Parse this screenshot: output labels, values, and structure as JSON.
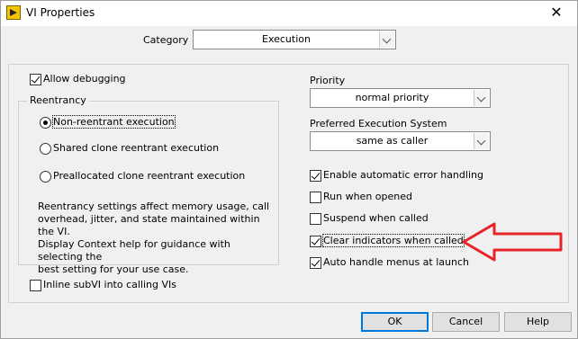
{
  "window": {
    "title": "VI Properties",
    "close_label": "✕"
  },
  "category": {
    "label": "Category",
    "value": "Execution"
  },
  "allow_debugging": {
    "label": "Allow debugging",
    "checked": true
  },
  "reentrancy": {
    "title": "Reentrancy",
    "options": [
      {
        "label": "Non-reentrant execution",
        "selected": true
      },
      {
        "label": "Shared clone reentrant execution",
        "selected": false
      },
      {
        "label": "Preallocated clone reentrant execution",
        "selected": false
      }
    ],
    "description": "Reentrancy settings affect memory usage, call\noverhead, jitter, and state maintained within the VI.\nDisplay Context help for guidance with selecting the\nbest setting for your use case."
  },
  "inline_subvi": {
    "label": "Inline subVI into calling VIs",
    "checked": false
  },
  "priority": {
    "label": "Priority",
    "value": "normal priority"
  },
  "exec_system": {
    "label": "Preferred Execution System",
    "value": "same as caller"
  },
  "options": [
    {
      "label": "Enable automatic error handling",
      "checked": true
    },
    {
      "label": "Run when opened",
      "checked": false
    },
    {
      "label": "Suspend when called",
      "checked": false
    },
    {
      "label": "Clear indicators when called",
      "checked": true
    },
    {
      "label": "Auto handle menus at launch",
      "checked": true
    }
  ],
  "buttons": {
    "ok": "OK",
    "cancel": "Cancel",
    "help": "Help"
  },
  "annotation": {
    "arrow_color": "#e8232a"
  }
}
